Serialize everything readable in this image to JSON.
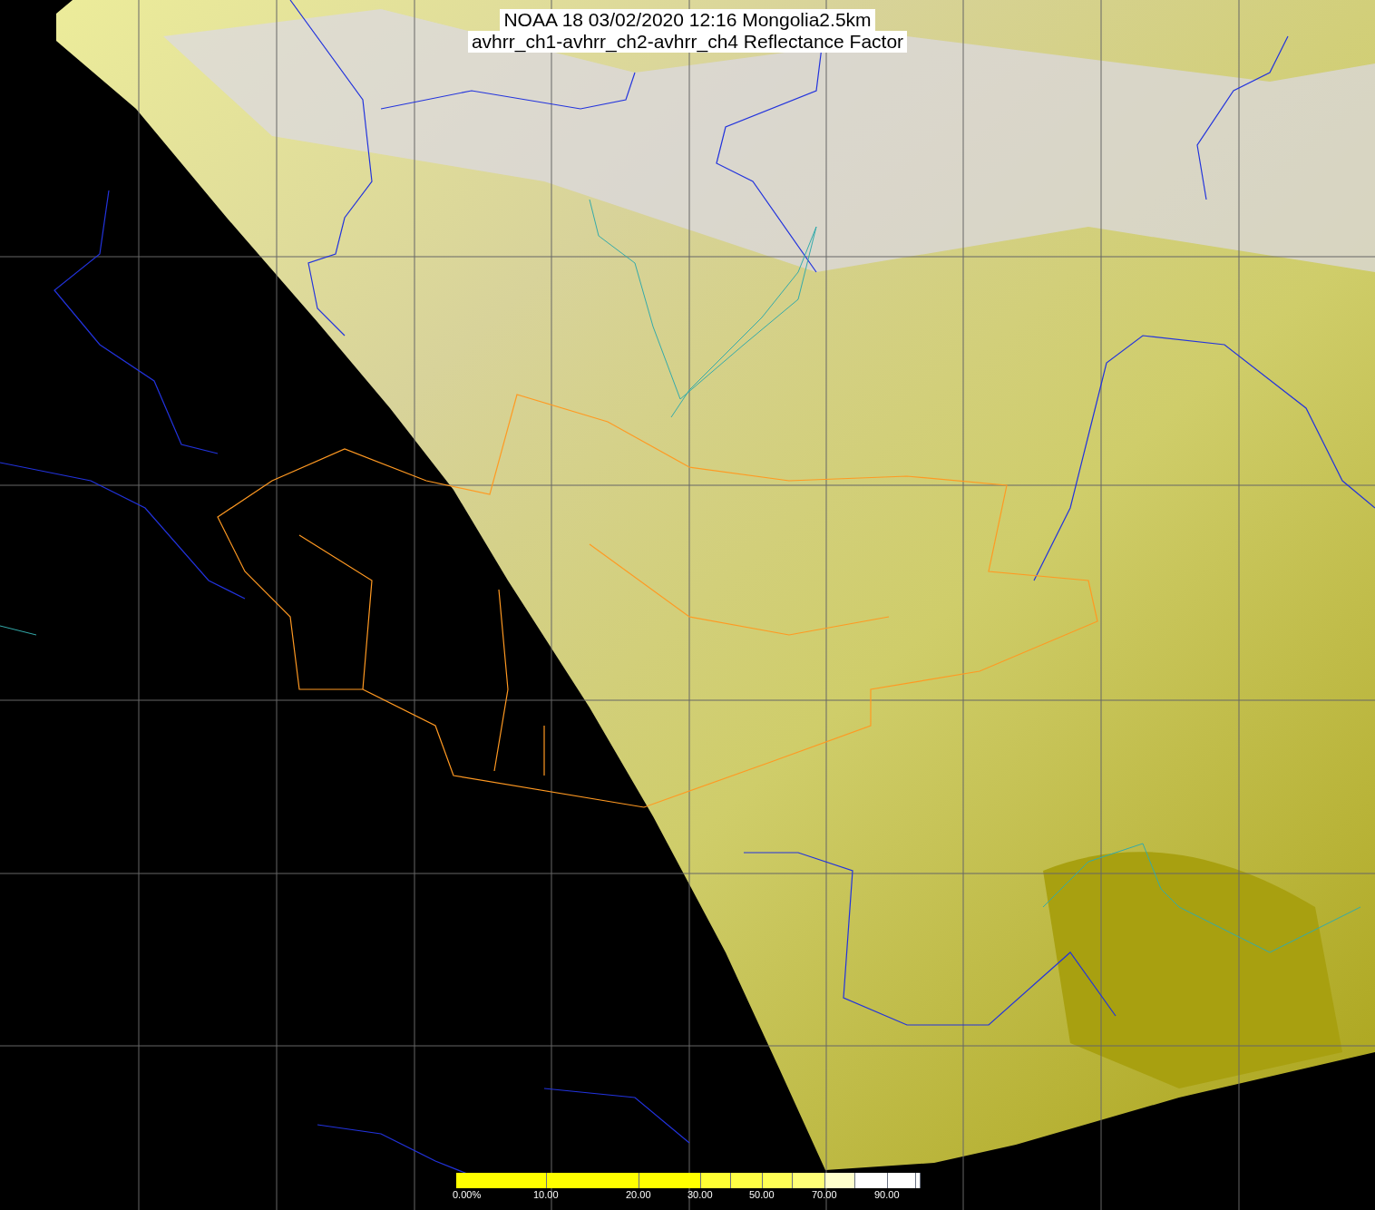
{
  "title": {
    "lines": [
      "NOAA 18 03/02/2020 12:16 Mongolia2.5km",
      "avhrr_ch1-avhrr_ch2-avhrr_ch4 Reflectance Factor"
    ]
  },
  "colorbar": {
    "segments": [
      {
        "color": "#ffff00",
        "label": "0.00%"
      },
      {
        "color": "#ffff00",
        "label": "10.00"
      },
      {
        "color": "#ffff00",
        "label": "20.00"
      },
      {
        "color": "#ffff33",
        "label": "30.00"
      },
      {
        "color": "#ffff44"
      },
      {
        "color": "#ffff55",
        "label": "50.00"
      },
      {
        "color": "#ffff77"
      },
      {
        "color": "#ffffcc",
        "label": "70.00"
      },
      {
        "color": "#ffffff"
      },
      {
        "color": "#ffffff",
        "label": "90.00"
      },
      {
        "color": "#ffffff"
      }
    ]
  }
}
